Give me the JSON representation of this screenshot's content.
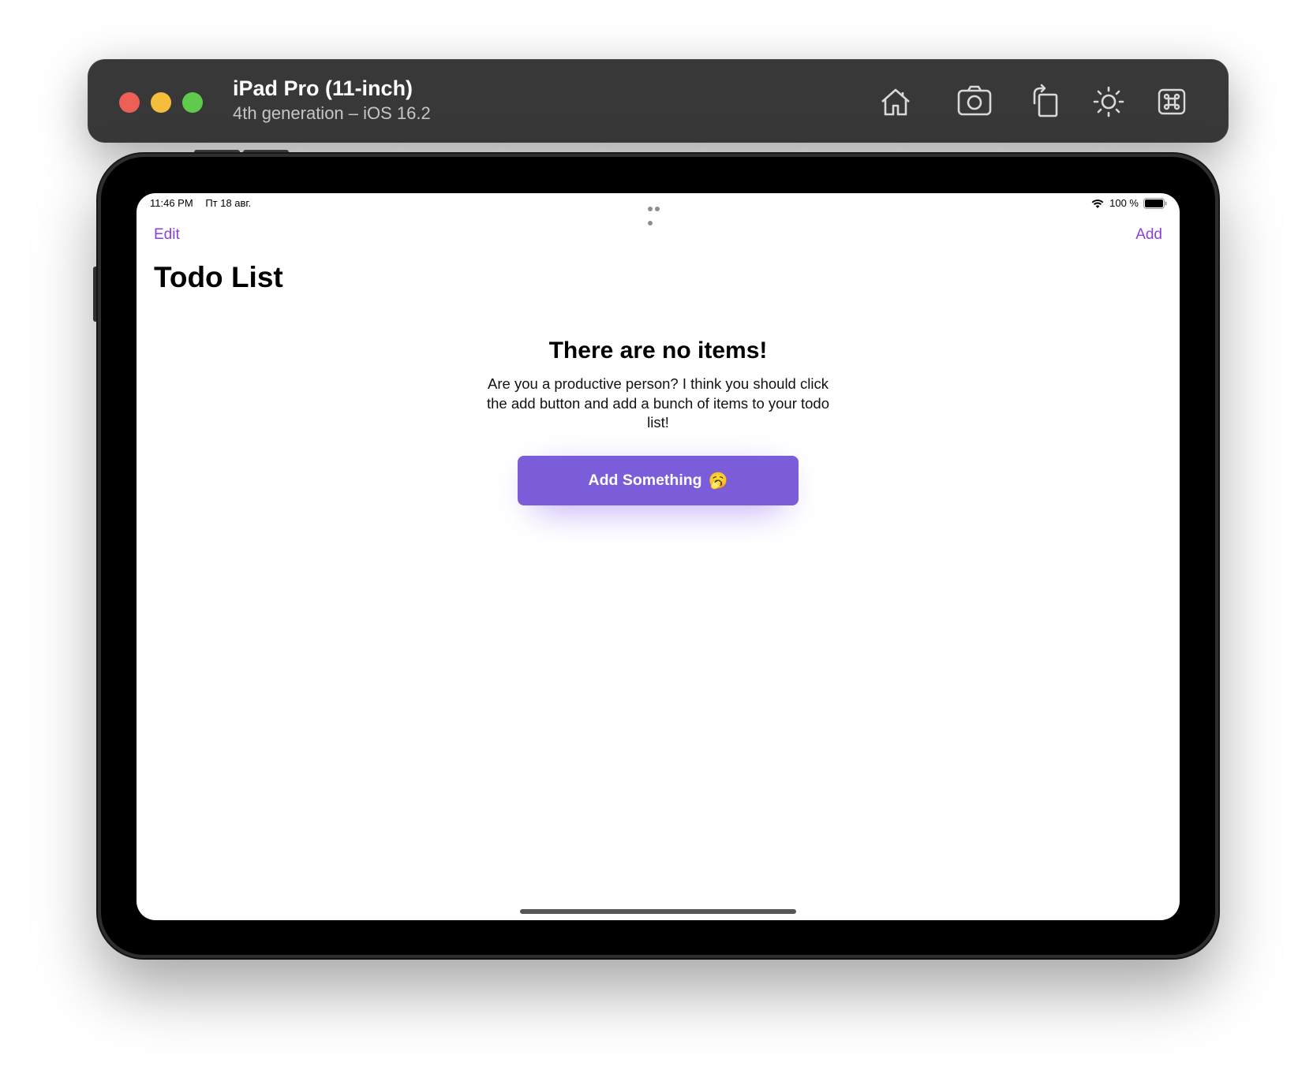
{
  "simulator": {
    "device_name": "iPad Pro (11-inch)",
    "device_subtitle": "4th generation – iOS 16.2",
    "toolbar_icons": [
      "home-icon",
      "screenshot-icon",
      "rotate-icon",
      "brightness-icon",
      "command-icon"
    ]
  },
  "status_bar": {
    "time": "11:46 PM",
    "date": "Пт 18 авг.",
    "battery_text": "100 %"
  },
  "nav": {
    "edit_label": "Edit",
    "add_label": "Add"
  },
  "page": {
    "title": "Todo List"
  },
  "empty_state": {
    "heading": "There are no items!",
    "body": "Are you a productive person? I think you should click the add button and add a bunch of items to your todo list!",
    "button_label": "Add Something",
    "button_emoji": "🥱"
  },
  "colors": {
    "accent": "#8a3fe0",
    "button": "#7b5cd9",
    "titlebar": "#383838"
  }
}
